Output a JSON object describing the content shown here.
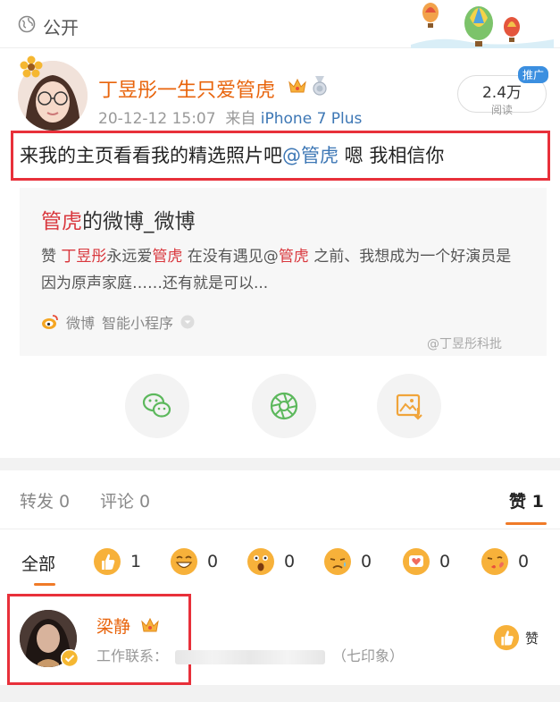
{
  "header": {
    "visibility": "公开",
    "globe_icon": "globe-icon",
    "decoration_icon": "hot-air-balloons-icon"
  },
  "post": {
    "author": "丁昱彤一生只爱管虎",
    "timestamp": "20-12-12 15:07",
    "source_prefix": "来自",
    "source": "iPhone 7 Plus",
    "reads": "2.4万",
    "reads_label": "阅读",
    "promo_badge": "推广",
    "text_part1": "来我的主页看看我的精选照片吧",
    "mention": "@管虎",
    "text_part2": " 嗯 我相信你"
  },
  "card": {
    "title_highlight": "管虎",
    "title_rest": "的微博_微博",
    "desc_1": "赞 ",
    "desc_name": "丁昱彤",
    "desc_2": "永远爱",
    "desc_name2": "管虎",
    "desc_3": " 在没有遇见@",
    "desc_name3": "管虎",
    "desc_4": " 之前、我想成为一个好演员是因为原声家庭……还有就是可以...",
    "footer_source": "微博",
    "footer_type": "智能小程序",
    "watermark": "@丁昱彤科批"
  },
  "stats": {
    "repost": "转发 0",
    "comment": "评论 0",
    "like": "赞 1"
  },
  "filters": {
    "all": "全部",
    "reactions": [
      {
        "icon": "thumbs-up-icon",
        "count": "1"
      },
      {
        "icon": "laugh-icon",
        "count": "0"
      },
      {
        "icon": "surprised-icon",
        "count": "0"
      },
      {
        "icon": "sad-icon",
        "count": "0"
      },
      {
        "icon": "heart-icon",
        "count": "0"
      },
      {
        "icon": "kiss-icon",
        "count": "0"
      }
    ]
  },
  "liker": {
    "name": "梁静",
    "desc_prefix": "工作联系：",
    "desc_suffix": "（七印象）",
    "like_label": "赞"
  },
  "colors": {
    "accent_orange": "#f07b28",
    "name_orange": "#e8640c",
    "link_blue": "#3d77b5",
    "highlight_red": "#e8303a"
  }
}
